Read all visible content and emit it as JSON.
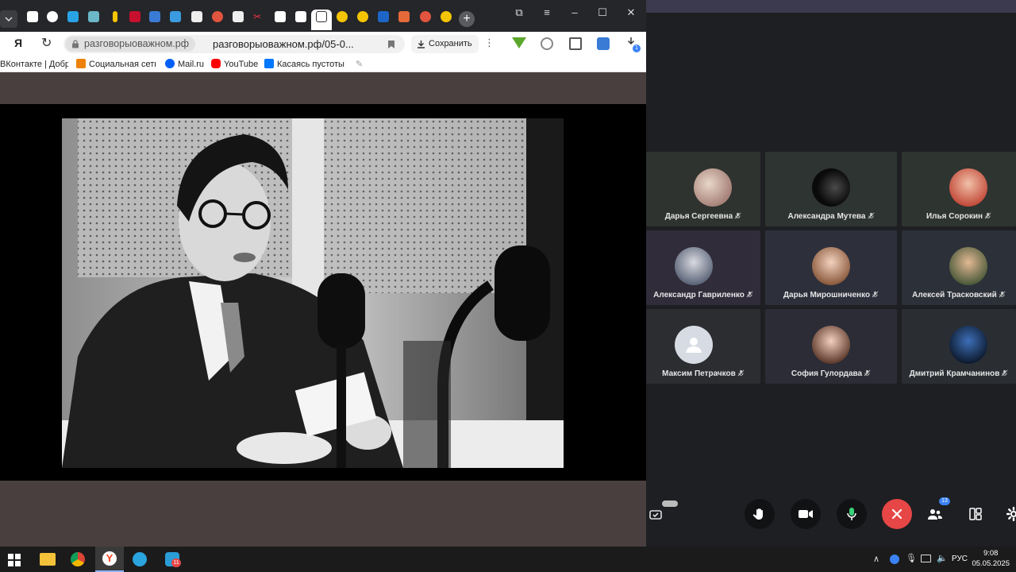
{
  "browser": {
    "address": {
      "host": "разговорыоважном.рф",
      "path": "разговорыоважном.рф/05-0..."
    },
    "save_label": "Сохранить",
    "bookmarks": [
      {
        "label": "ВКонтакте | Добр",
        "color": "#2787f5"
      },
      {
        "label": "Социальная сеть",
        "color": "#ee8208"
      },
      {
        "label": "Mail.ru",
        "color": "#005ff9"
      },
      {
        "label": "YouTube",
        "color": "#ff0000"
      },
      {
        "label": "Касаясь пустоты",
        "color": "#0077ff"
      }
    ],
    "download_badge": "1"
  },
  "meeting": {
    "participants": [
      {
        "name": "Дарья Сергеевна"
      },
      {
        "name": "Александра Мутева"
      },
      {
        "name": "Илья Сорокин"
      },
      {
        "name": "Александр Гавриленко"
      },
      {
        "name": "Дарья Мирошниченко"
      },
      {
        "name": "Алексей Трасковский"
      },
      {
        "name": "Максим Петрачков"
      },
      {
        "name": "София Гулордава"
      },
      {
        "name": "Дмитрий Крамчанинов"
      }
    ],
    "participants_badge": "13"
  },
  "taskbar": {
    "telegram_badge": "11",
    "lang": "РУС",
    "time": "9:08",
    "date": "05.05.2025"
  },
  "colors": {
    "hangup": "#e64646",
    "yandex": "#fc3f1d",
    "accent": "#3b82f6"
  }
}
